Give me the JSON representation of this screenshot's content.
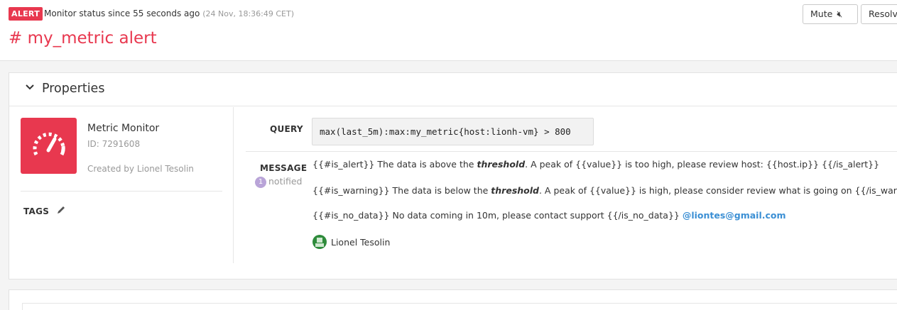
{
  "header": {
    "badge": "ALERT",
    "status": "Monitor status since 55 seconds ago",
    "status_time": "(24 Nov, 18:36:49 CET)",
    "title": "# my_metric alert",
    "mute_label": "Mute",
    "resolve_label": "Resolve"
  },
  "properties": {
    "section_title": "Properties",
    "monitor_type": "Metric Monitor",
    "monitor_id": "ID: 7291608",
    "created_by": "Created by Lionel Tesolin",
    "tags_label": "TAGS"
  },
  "query": {
    "label": "QUERY",
    "value": "max(last_5m):max:my_metric{host:lionh-vm} > 800"
  },
  "message": {
    "label": "MESSAGE",
    "notified_count": "1",
    "notified_label": "notified",
    "lines": [
      {
        "pre": "{{#is_alert}} The data is above the ",
        "em": "threshold",
        "post": ". A peak of {{value}} is too high, please review host: {{host.ip}} {{/is_alert}}"
      },
      {
        "pre": "{{#is_warning}} The data is below the ",
        "em": "threshold",
        "post": ". A peak of {{value}} is high, please consider review what is going on {{/is_warning}}"
      },
      {
        "pre": "{{#is_no_data}} No data coming in 10m, please contact support {{/is_no_data}} ",
        "mention": "@liontes@gmail.com"
      }
    ],
    "author": "Lionel Tesolin"
  },
  "colors": {
    "accent": "#e8384f",
    "mention": "#3b8fd4",
    "notif_badge": "#b9a4d8"
  },
  "icons": {
    "mute": "speaker-mute-icon",
    "collapse": "chevron-down-icon",
    "monitor": "speedometer-icon",
    "edit": "pencil-icon"
  }
}
